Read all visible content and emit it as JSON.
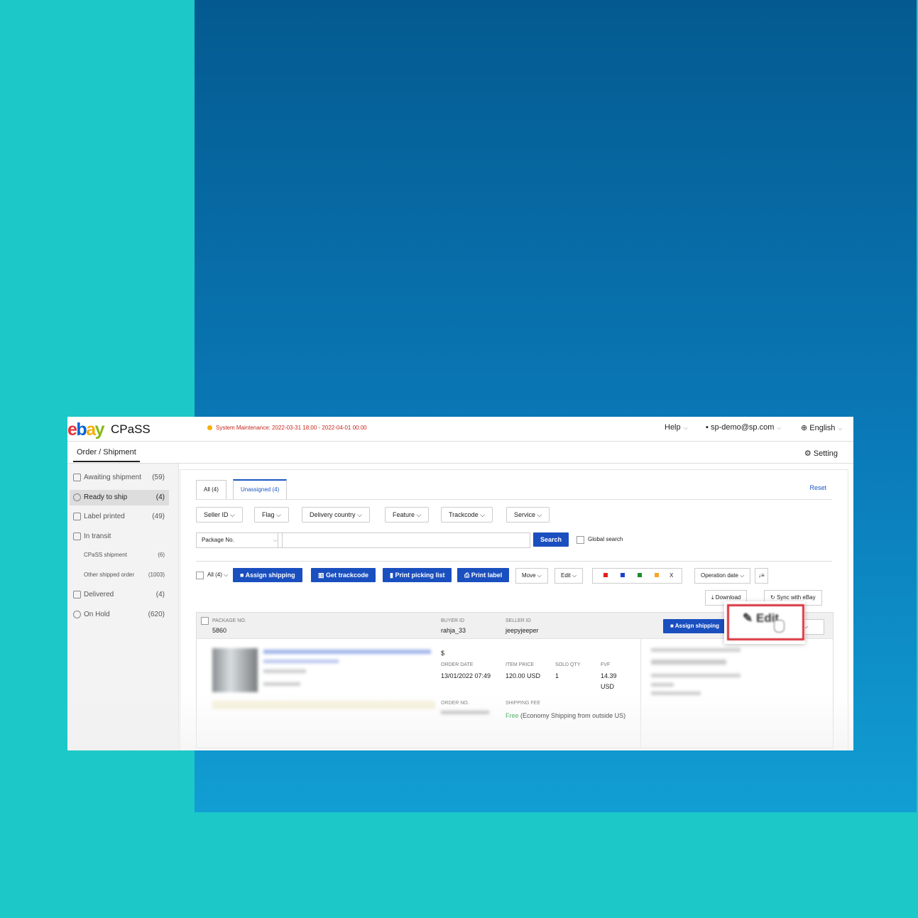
{
  "header": {
    "logo": {
      "e": "e",
      "b": "b",
      "a": "a",
      "y": "y"
    },
    "product": "CPaSS",
    "maintenance": "System Maintenance: 2022-03-31 18:00 - 2022-04-01 00:00",
    "help": "Help",
    "account": "sp-demo@sp.com",
    "language": "English"
  },
  "subnav": {
    "tab": "Order / Shipment",
    "setting": "Setting"
  },
  "sidebar": {
    "items": [
      {
        "label": "Awaiting shipment",
        "count": "(59)"
      },
      {
        "label": "Ready to ship",
        "count": "(4)"
      },
      {
        "label": "Label printed",
        "count": "(49)"
      },
      {
        "label": "In transit",
        "count": ""
      },
      {
        "label": "CPaSS shipment",
        "count": "(6)"
      },
      {
        "label": "Other shipped order",
        "count": "(1003)"
      },
      {
        "label": "Delivered",
        "count": "(4)"
      },
      {
        "label": "On Hold",
        "count": "(620)"
      }
    ]
  },
  "tabs": [
    {
      "label": "All (4)"
    },
    {
      "label": "Unassigned (4)"
    }
  ],
  "reset": "Reset",
  "filters": [
    "Seller ID",
    "Flag",
    "Delivery country",
    "Feature",
    "Trackcode",
    "Service"
  ],
  "search": {
    "select": "Package No.",
    "button": "Search",
    "global": "Global search"
  },
  "actions": {
    "all": "All (4)",
    "assign": "Assign shipping",
    "trackcode": "Get trackcode",
    "picking": "Print picking list",
    "label": "Print label",
    "move": "Move",
    "edit": "Edit",
    "x": "X",
    "sort": "Operation date",
    "download": "Download",
    "sync": "Sync with eBay"
  },
  "flag_colors": [
    "#e02020",
    "#1a3fd6",
    "#1e8a2e",
    "#f5a623"
  ],
  "order": {
    "package_label": "PACKAGE NO.",
    "package": "5860",
    "buyer_label": "BUYER ID",
    "buyer": "rahja_33",
    "seller_label": "SELLER ID",
    "seller": "jeepyjeeper",
    "assign": "Assign shipping",
    "currency": "$",
    "order_date_label": "ORDER DATE",
    "order_date": "13/01/2022 07:49",
    "item_price_label": "ITEM PRICE",
    "item_price": "120.00 USD",
    "sold_qty_label": "SOLD QTY",
    "sold_qty": "1",
    "fvf_label": "FVF",
    "fvf": "14.39",
    "fvf_unit": "USD",
    "order_no_label": "ORDER NO.",
    "shipping_fee_label": "SHIPPING FEE",
    "shipping_free": "Free",
    "shipping_detail": "(Economy Shipping from outside US)"
  },
  "popup": {
    "edit": "Edit"
  }
}
